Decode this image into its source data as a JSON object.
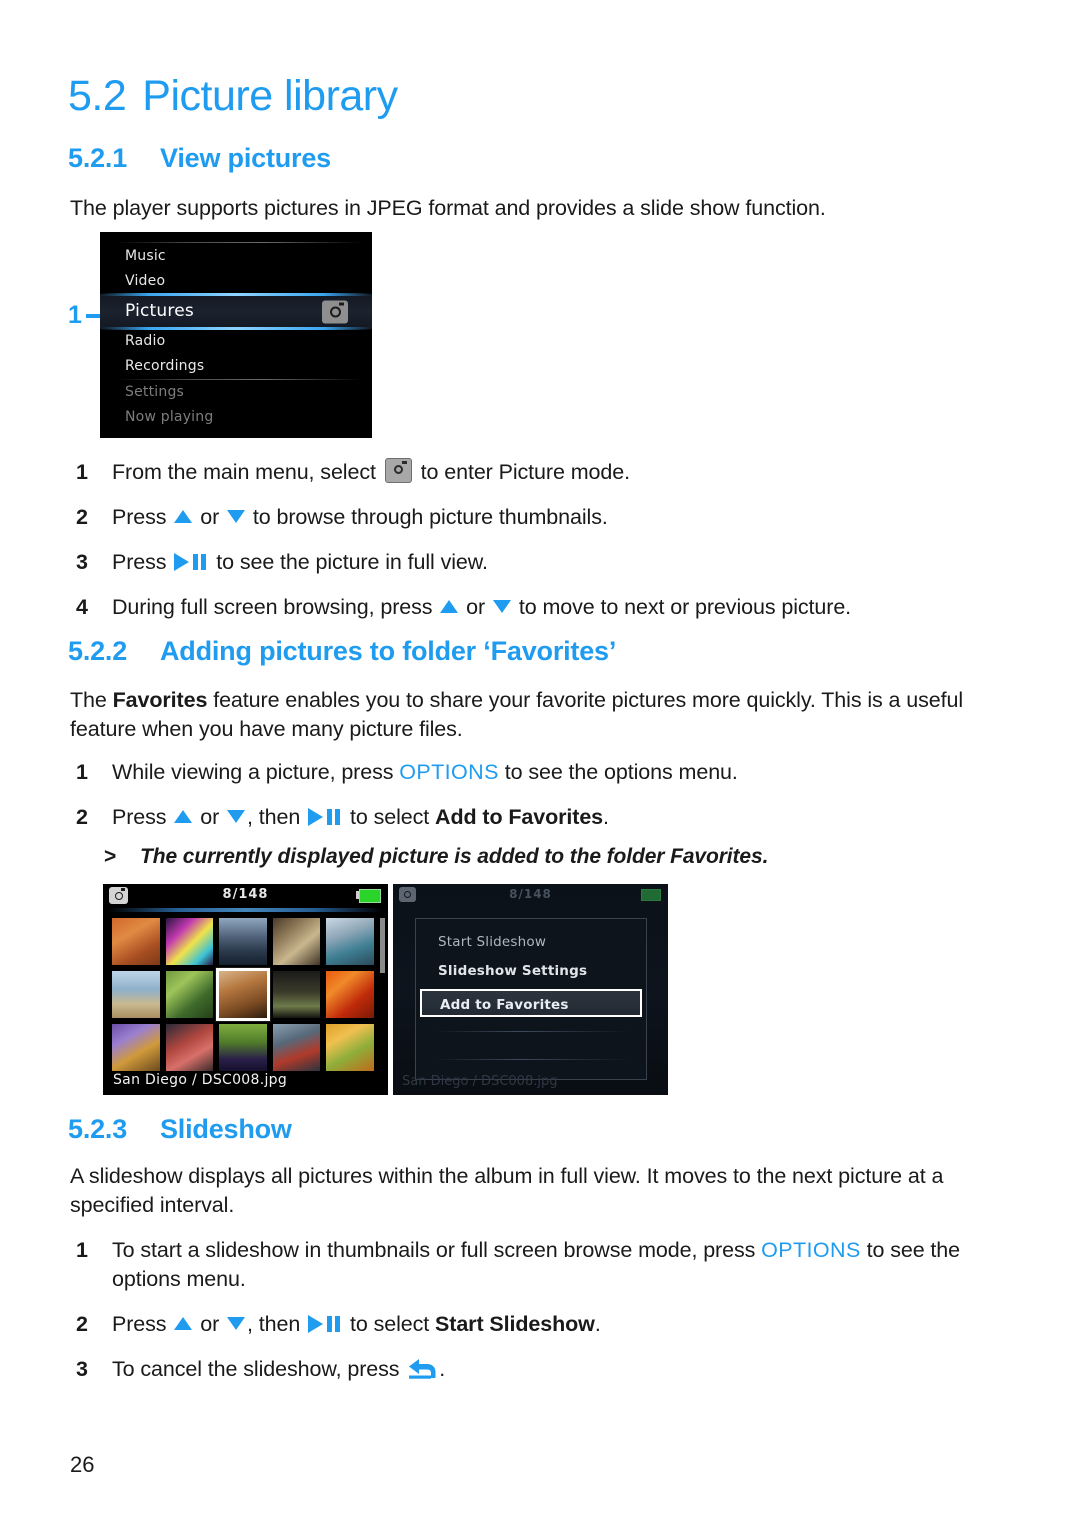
{
  "document": {
    "page_number": "26",
    "section_title": {
      "number": "5.2",
      "text": "Picture library"
    },
    "subsections": [
      {
        "number": "5.2.1",
        "title": "View pictures",
        "intro": "The player supports pictures in JPEG format and provides a slide show function.",
        "steps": [
          {
            "marker": "1",
            "prefix": "From the main menu, select ",
            "icon": "camera-icon",
            "suffix": " to enter Picture mode."
          },
          {
            "marker": "2",
            "prefix": "Press ",
            "suffix": " to browse through picture thumbnails.",
            "mid": " or "
          },
          {
            "marker": "3",
            "prefix": "Press ",
            "suffix": " to see the picture in full view."
          },
          {
            "marker": "4",
            "prefix": "During full screen browsing, press ",
            "mid": " or ",
            "suffix": " to move to next or previous picture."
          }
        ]
      },
      {
        "number": "5.2.2",
        "title": "Adding pictures to folder ‘Favorites’",
        "intro_part1": "The ",
        "intro_bold": "Favorites",
        "intro_part2": " feature enables you to share your favorite pictures more quickly. This is a useful feature when you have many picture files.",
        "steps": [
          {
            "marker": "1",
            "prefix": "While viewing a picture, press ",
            "keyword": "OPTIONS",
            "suffix": " to see the options menu."
          },
          {
            "marker": "2",
            "prefix": "Press ",
            "mid": " or ",
            "mid2": ", then ",
            "suffix_prefix": " to select ",
            "bold": "Add to Favorites",
            "suffix": "."
          }
        ],
        "note_marker": ">",
        "note": "The currently displayed picture is added to the folder Favorites."
      },
      {
        "number": "5.2.3",
        "title": "Slideshow",
        "intro": "A slideshow displays all pictures within the album in full view. It moves to the next picture at a specified interval.",
        "steps": [
          {
            "marker": "1",
            "prefix": "To start a slideshow in thumbnails or full screen browse mode, press ",
            "keyword": "OPTIONS",
            "suffix": " to see the options menu."
          },
          {
            "marker": "2",
            "prefix": "Press ",
            "mid": " or ",
            "mid2": ", then ",
            "suffix_prefix": " to select ",
            "bold": "Start Slideshow",
            "suffix": "."
          },
          {
            "marker": "3",
            "prefix": "To cancel the slideshow, press ",
            "suffix": "."
          }
        ]
      }
    ]
  },
  "callout": {
    "number": "1",
    "icon": "arrow-right-icon"
  },
  "device_screens": {
    "main_menu": {
      "items": [
        {
          "label": "Music",
          "state": "normal"
        },
        {
          "label": "Video",
          "state": "normal"
        },
        {
          "label": "Pictures",
          "state": "selected",
          "icon": "camera-icon"
        },
        {
          "label": "Radio",
          "state": "normal"
        },
        {
          "label": "Recordings",
          "state": "normal"
        },
        {
          "label": "Settings",
          "state": "dim"
        },
        {
          "label": "Now playing",
          "state": "dim"
        }
      ]
    },
    "thumbnails": {
      "counter": "8/148",
      "filename": "San Diego / DSC008.jpg",
      "camera_icon": "camera-icon",
      "battery_icon": "battery-icon",
      "selected_index": 7,
      "thumbs": [
        "linear-gradient(150deg,#d2682c 0%,#e08a43 35%,#a84e22 70%,#7c3a18 100%)",
        "linear-gradient(135deg,#2a1540 0%,#c23ab0 30%,#f0e24a 55%,#3ac2d6 80%,#2a1540 100%)",
        "linear-gradient(180deg,#8fa7bf 0%,#51637a 40%,#2b3a4c 70%,#16212e 100%)",
        "linear-gradient(140deg,#4a3a2a 0%,#8b7655 30%,#c9b78e 60%,#3f3326 100%)",
        "linear-gradient(160deg,#cbd8e4 0%,#8fa7b8 35%,#3f7f94 65%,#2b4a5c 100%)",
        "linear-gradient(180deg,#bcd4e8 0%,#8fb0c9 40%,#c9b98f 70%,#a88f63 100%)",
        "linear-gradient(140deg,#6f9a3f 0%,#9ec45a 30%,#3f6b2b 65%,#24401a 100%)",
        "linear-gradient(160deg,#d8b48a 0%,#b5773f 35%,#7a4a22 70%,#2d1c0f 100%)",
        "linear-gradient(180deg,#1a1a1a 0%,#3b3b2a 45%,#6e7a4a 75%,#141410 100%)",
        "linear-gradient(140deg,#e85a10 0%,#f08a2a 30%,#c02a0a 65%,#7a1a05 100%)",
        "linear-gradient(150deg,#6a4fa8 0%,#9b7fd0 30%,#d09a3a 60%,#6b4a1f 100%)",
        "linear-gradient(150deg,#2a2a38 0%,#b0473f 40%,#d8706a 65%,#3a2a2a 100%)",
        "linear-gradient(180deg,#7fae3f 0%,#4f7a2a 40%,#2a1f4a 75%,#15102a 100%)",
        "linear-gradient(160deg,#8aa0b0 0%,#56697a 35%,#b03a2a 65%,#2a3440 100%)",
        "linear-gradient(150deg,#e0a02a 0%,#f0c050 30%,#8fae3a 60%,#c06a1a 100%)"
      ]
    },
    "options_menu": {
      "counter": "8/148",
      "ghost_filename": "San Diego / DSC008.jpg",
      "items": [
        {
          "label": "Start Slideshow",
          "state": "normal"
        },
        {
          "label": "Slideshow Settings",
          "state": "bold"
        },
        {
          "label": "Add to Favorites",
          "state": "highlight"
        }
      ]
    }
  },
  "colors": {
    "accent_blue": "#1f9cf0",
    "text": "#1a1a1a"
  }
}
